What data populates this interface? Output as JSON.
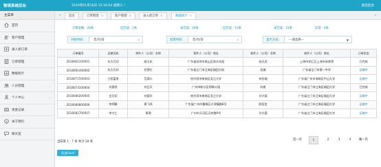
{
  "app": {
    "title": "物流系统后台",
    "date": "2019年01月16日 15:16:04 星期三 !",
    "logout": "退出后台"
  },
  "sidebar": {
    "header": "主菜单",
    "items": [
      {
        "label": "首页",
        "icon": "home-icon",
        "arrow": ""
      },
      {
        "label": "客户管理",
        "icon": "customer-icon",
        "arrow": ""
      },
      {
        "label": "录入新订单",
        "icon": "new-order-icon",
        "arrow": ""
      },
      {
        "label": "订单管理",
        "icon": "order-list-icon",
        "arrow": ""
      },
      {
        "label": "数据统计",
        "icon": "stats-icon",
        "arrow": ""
      },
      {
        "label": "人员管理",
        "icon": "staff-icon",
        "arrow": "‹"
      },
      {
        "label": "个人中心",
        "icon": "user-icon",
        "arrow": "‹"
      },
      {
        "label": "资金记录",
        "icon": "money-icon",
        "arrow": ""
      },
      {
        "label": "关于我们",
        "icon": "about-icon",
        "arrow": ""
      },
      {
        "label": "聊天室",
        "icon": "chat-icon",
        "arrow": ""
      }
    ]
  },
  "tabs": {
    "prev": "«",
    "next": "»",
    "items": [
      {
        "label": "首页",
        "closable": false
      },
      {
        "label": "订单管理",
        "closable": true
      },
      {
        "label": "客户管理",
        "closable": true
      },
      {
        "label": "录入新订单",
        "closable": true
      },
      {
        "label": "数据统计",
        "closable": true
      }
    ],
    "close": "×"
  },
  "summary": {
    "total": "订单总数：28条",
    "completed": "已完成：2条",
    "incomplete": "未完成：26条",
    "shipped": "已完成：13条",
    "not_shipped": "未完成：15条",
    "abnormal": "异常：0条"
  },
  "filters": {
    "start_label": "开始时间：",
    "start_value": "年/月/日",
    "end_label": "结束时间：",
    "end_value": "年/月/日",
    "display_label": "显示方式：",
    "display_value": "---请选择---",
    "calendar_glyph": "▫",
    "caret": "▼"
  },
  "table": {
    "headers": [
      "订单编号",
      "运输司机",
      "寄件人（公司）名称",
      "寄件人（公司）地址",
      "收件人（公司）名称",
      "收件人（公司）地址",
      "订单状态"
    ],
    "rows": [
      [
        "2018061100001",
        "东方月初",
        "姚玉花",
        "广东省深圳市南山区南头花园",
        "张无虎",
        "上海市徐汇区上海市体育馆",
        "已完成"
      ],
      [
        "2018061400002",
        "东方月初",
        "任我行",
        "广东省江门市江海区福田大街",
        "吴美",
        "广东省江门市第一中学",
        "运输中"
      ],
      [
        "2018071500003",
        "王权富贵",
        "范满义",
        "哈尔滨市南岗区龙江大学",
        "林东端",
        "广东省广州市海珠区中山大学",
        "运输中"
      ],
      [
        "2018073100004",
        "刘昌恒",
        "刘日天",
        "广州市新沙区明珠公园",
        "向夜",
        "广东省江门市江海区福田大学",
        "已完成"
      ],
      [
        "2018080200005",
        "白月初",
        "刘德华",
        "哈尔滨市南岗区龙江大学",
        "孙大德",
        "广东省江门市江海区福田大学",
        "运输中"
      ],
      [
        "2018080800006",
        "李明静",
        "黄飞鸿",
        "广东省广州市番禺区沙湾镇路8号",
        "欧伍信",
        "广东省江门市江海区福田大学",
        "运输中"
      ],
      [
        "2018082700007",
        "李大仁",
        "萧潮",
        "广州市天河区天府路9号",
        "孙大德",
        "广东省江门市江海区福田大学",
        "运输中"
      ]
    ]
  },
  "pagination": {
    "info": "当前第 1 - 7 条  共计 28 条",
    "first": "首一页",
    "pages": [
      "1",
      "2",
      "3",
      "4"
    ],
    "current": "1",
    "last": "尾一页"
  },
  "export_button": "导出Excel",
  "colors": {
    "accent": "#1fa5c8",
    "summary_text": "#1f8fb8",
    "export_button": "#2fb0d8"
  }
}
